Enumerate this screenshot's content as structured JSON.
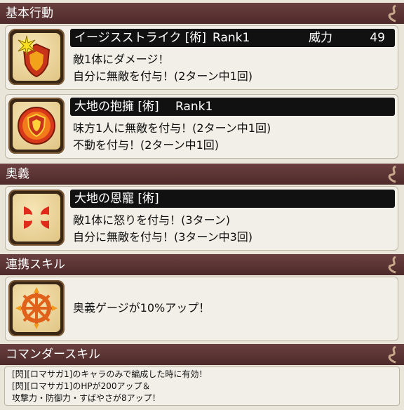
{
  "sections": {
    "basic": "基本行動",
    "ougi": "奥義",
    "renkei": "連携スキル",
    "commander": "コマンダースキル"
  },
  "skills": {
    "s1": {
      "name": "イージスストライク [術]",
      "rank": "Rank1",
      "power_label": "威力",
      "power_value": "49",
      "lines": [
        "敵1体にダメージ！",
        "自分に無敵を付与！(2ターン中1回)"
      ]
    },
    "s2": {
      "name": "大地の抱擁 [術]",
      "rank": "Rank1",
      "lines": [
        "味方1人に無敵を付与！(2ターン中1回)",
        "不動を付与！(2ターン中1回)"
      ]
    },
    "s3": {
      "name": "大地の恩寵 [術]",
      "lines": [
        "敵1体に怒りを付与！(3ターン)",
        "自分に無敵を付与！(3ターン中3回)"
      ]
    },
    "s4": {
      "line": "奥義ゲージが10%アップ！"
    }
  },
  "commander_notes": [
    "[閃][ロマサガ1]のキャラのみで編成した時に有効！",
    "[閃][ロマサガ1]のHPが200アップ＆",
    "攻撃力・防御力・すばやさが8アップ！"
  ],
  "colors": {
    "header": "#5b3434",
    "card_bg": "#f1efe7",
    "title_bar": "#111111"
  }
}
